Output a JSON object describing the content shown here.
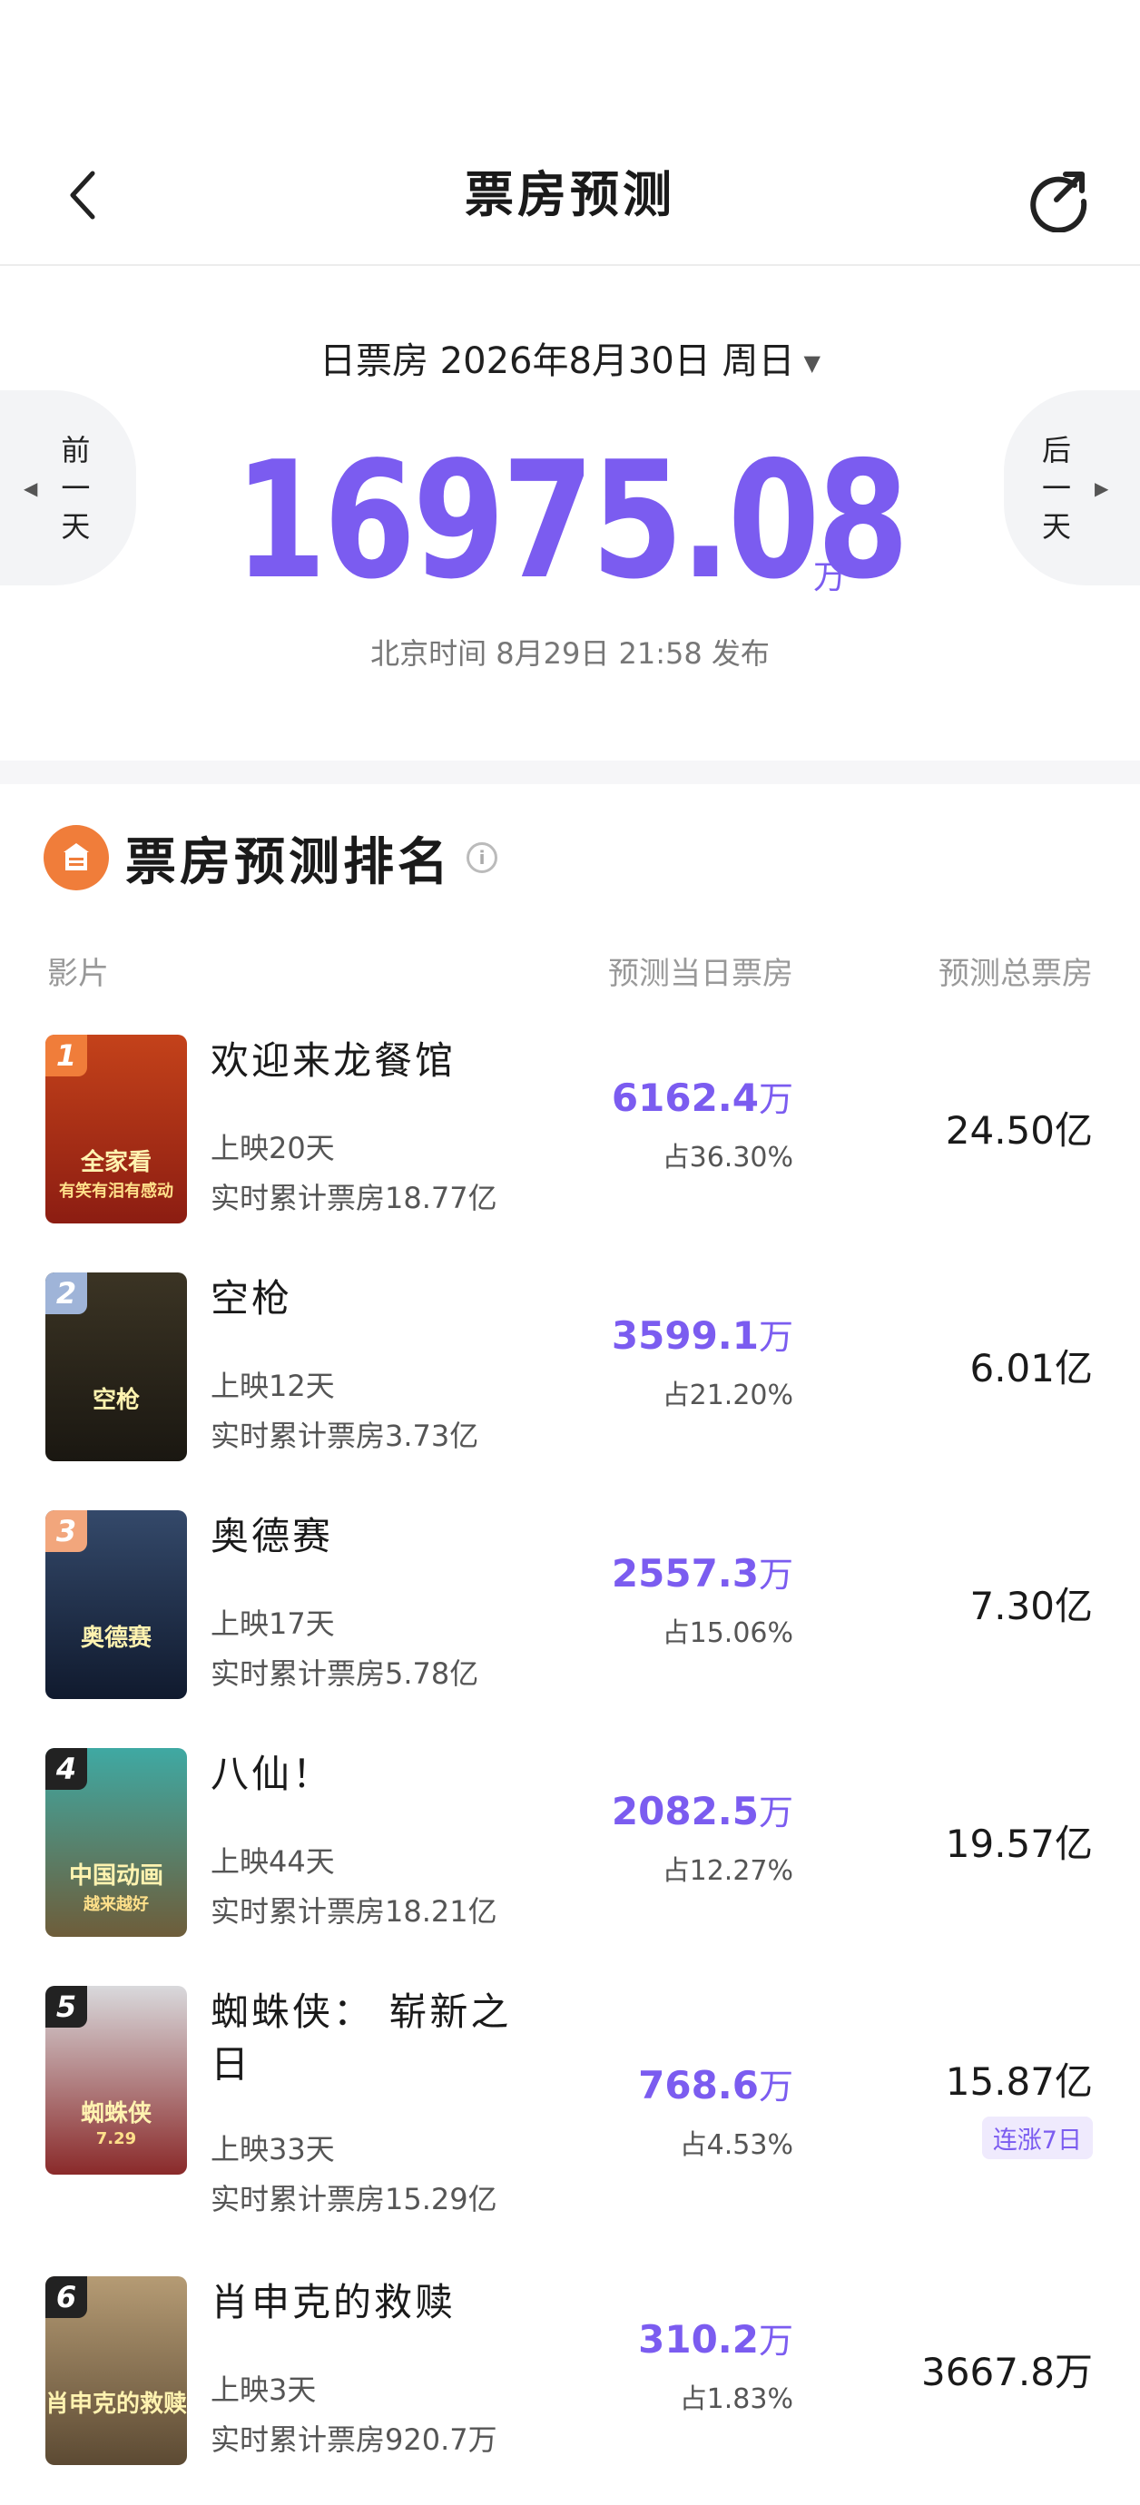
{
  "header": {
    "title": "票房预测",
    "back_icon": "chevron-left-icon",
    "share_icon": "share-icon"
  },
  "summary": {
    "date_label": "日票房 2026年8月30日 周日",
    "caret": "▼",
    "prev_day": [
      "前",
      "一",
      "天"
    ],
    "next_day": [
      "后",
      "一",
      "天"
    ],
    "total_value": "16975.08",
    "total_unit": "万",
    "publish_time": "北京时间 8月29日 21:58 发布"
  },
  "ranking": {
    "title": "票房预测排名",
    "info_icon": "info-icon",
    "columns": {
      "film": "影片",
      "daily": "预测当日票房",
      "total": "预测总票房"
    },
    "films": [
      {
        "rank": "1",
        "name": "欢迎来龙餐馆",
        "days": "上映20天",
        "cumulative": "实时累计票房18.77亿",
        "daily_value": "6162.4",
        "daily_unit": "万",
        "share": "占36.30%",
        "total": "24.50亿",
        "badge_color": "#f07d3a",
        "poster_text_1": "全家看",
        "poster_text_2": "有笑有泪有感动",
        "poster_colors": [
          "#c4421a",
          "#8c1d12"
        ]
      },
      {
        "rank": "2",
        "name": "空枪",
        "days": "上映12天",
        "cumulative": "实时累计票房3.73亿",
        "daily_value": "3599.1",
        "daily_unit": "万",
        "share": "占21.20%",
        "total": "6.01亿",
        "badge_color": "#9fb4d8",
        "poster_text_1": "空枪",
        "poster_text_2": "",
        "poster_colors": [
          "#3b3424",
          "#1a1711"
        ]
      },
      {
        "rank": "3",
        "name": "奥德赛",
        "days": "上映17天",
        "cumulative": "实时累计票房5.78亿",
        "daily_value": "2557.3",
        "daily_unit": "万",
        "share": "占15.06%",
        "total": "7.30亿",
        "badge_color": "#f2a67c",
        "poster_text_1": "奥德赛",
        "poster_text_2": "",
        "poster_colors": [
          "#34496a",
          "#101a2e"
        ]
      },
      {
        "rank": "4",
        "name": "八仙！",
        "days": "上映44天",
        "cumulative": "实时累计票房18.21亿",
        "daily_value": "2082.5",
        "daily_unit": "万",
        "share": "占12.27%",
        "total": "19.57亿",
        "badge_color": "#222222",
        "poster_text_1": "中国动画",
        "poster_text_2": "越来越好",
        "poster_colors": [
          "#3fa9a3",
          "#6e5d3a"
        ]
      },
      {
        "rank": "5",
        "name": "蜘蛛侠： 崭新之日",
        "days": "上映33天",
        "cumulative": "实时累计票房15.29亿",
        "daily_value": "768.6",
        "daily_unit": "万",
        "share": "占4.53%",
        "total": "15.87亿",
        "streak": "连涨7日",
        "badge_color": "#222222",
        "poster_text_1": "蜘蛛侠",
        "poster_text_2": "7.29",
        "poster_colors": [
          "#d9d9dc",
          "#8a2a2a"
        ]
      },
      {
        "rank": "6",
        "name": "肖申克的救赎",
        "days": "上映3天",
        "cumulative": "实时累计票房920.7万",
        "daily_value": "310.2",
        "daily_unit": "万",
        "share": "占1.83%",
        "total": "3667.8万",
        "badge_color": "#222222",
        "poster_text_1": "肖申克的救赎",
        "poster_text_2": "",
        "poster_colors": [
          "#b59b74",
          "#5c4a33"
        ]
      }
    ]
  },
  "colors": {
    "accent": "#7b5cf0",
    "section_icon": "#f07d3a"
  }
}
